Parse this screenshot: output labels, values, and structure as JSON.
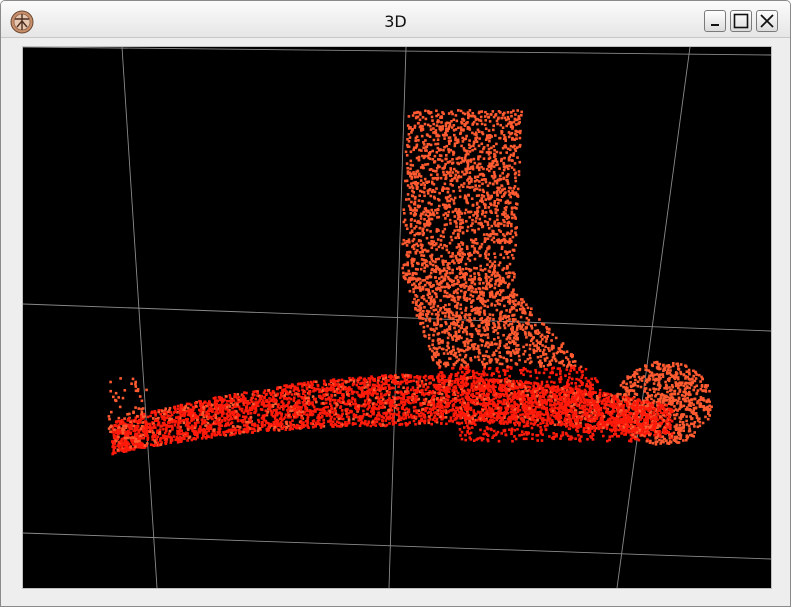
{
  "window": {
    "title": "3D",
    "app_icon": "app-logo-icon",
    "controls": {
      "minimize_icon": "minimize-icon",
      "maximize_icon": "maximize-icon",
      "close_icon": "close-icon"
    }
  },
  "viewport": {
    "background": "#000000",
    "grid_color": "#8a8a8a",
    "point_colors": {
      "dense": "#ff1a0a",
      "sparse": "#ff5a30"
    }
  }
}
